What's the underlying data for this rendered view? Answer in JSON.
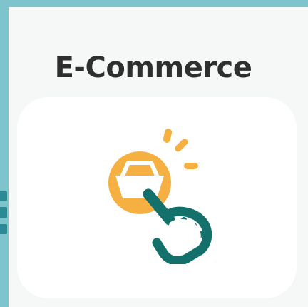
{
  "tile": {
    "title": "E-Commerce",
    "icon": "tap-shopping-basket-icon"
  },
  "colors": {
    "background_teal": "#7ec4cc",
    "card_background": "#f6f7f7",
    "tile_background": "#ffffff",
    "title_text": "#2f2f2f",
    "icon_orange": "#f5b041",
    "icon_dark_teal": "#13706b"
  }
}
